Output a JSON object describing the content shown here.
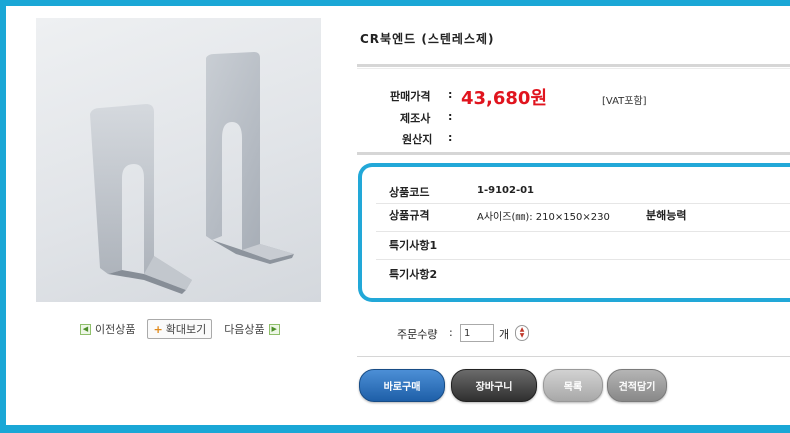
{
  "product": {
    "title": "CR북엔드 (스텐레스제)",
    "price_label": "판매가격",
    "price_value": "43,680원",
    "vat_note": "[VAT포함]",
    "maker_label": "제조사",
    "origin_label": "원산지",
    "colon": ":"
  },
  "nav": {
    "prev_label": "이전상품",
    "zoom_label": "확대보기",
    "next_label": "다음상품"
  },
  "specs": {
    "code_label": "상품코드",
    "code_value": "1-9102-01",
    "spec_label": "상품규격",
    "spec_value": "A사이즈(㎜): 210×150×230",
    "spec_extra": "분해능력",
    "note1_label": "특기사항1",
    "note2_label": "특기사항2"
  },
  "order": {
    "qty_label": "주문수량",
    "qty_value": "1",
    "qty_unit": "개"
  },
  "buttons": {
    "buy": "바로구매",
    "cart": "장바구니",
    "list": "목록",
    "quote": "견적담기"
  },
  "colors": {
    "frame": "#1aa7d6",
    "price": "#e0141e",
    "buy_button": "#1e5fa8"
  }
}
